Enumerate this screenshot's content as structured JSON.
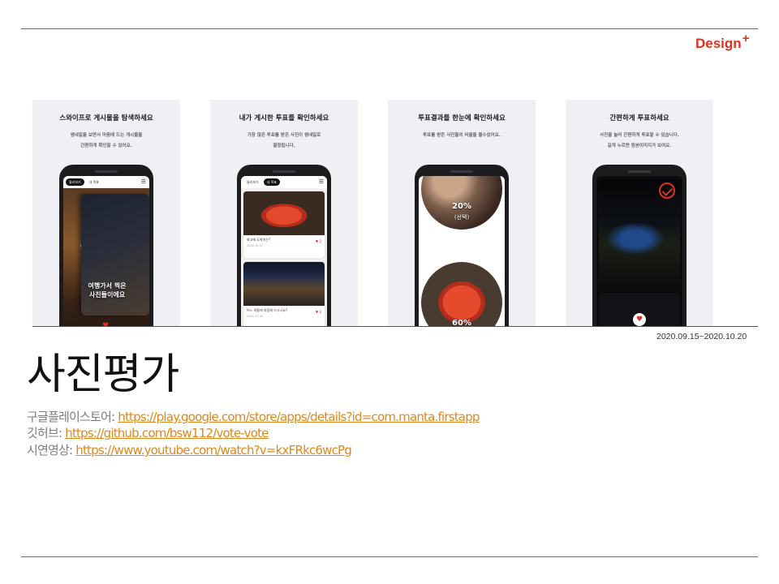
{
  "brand": {
    "text": "Design",
    "plus": "+"
  },
  "cards": [
    {
      "title": "스와이프로 게시물을 탐색하세요",
      "subtitle_line1": "썸네일을 보면서 마음에 드는 게시물을",
      "subtitle_line2": "간편하게 확인할 수 있어요.",
      "tabs": [
        "둘러보기",
        "내 목표"
      ],
      "caption_line1": "여행가서 찍은",
      "caption_line2": "사진들이에요"
    },
    {
      "title": "내가 게시한 투표를 확인하세요",
      "subtitle_line1": "가장 많은 투표를 받은 사진이 썸네일로",
      "subtitle_line2": "결정됩니다.",
      "tabs": [
        "둘러보기",
        "내 목표"
      ],
      "posts": [
        {
          "title": "최고에 도착하는?",
          "date": "2020.10.22",
          "likes": "5"
        },
        {
          "title": "어느 여름에 마음에 드시나요?",
          "date": "2020.10.22",
          "likes": "3"
        }
      ]
    },
    {
      "title": "투표결과를 한눈에 확인하세요",
      "subtitle_line1": "투표를 받은 사진들의 비율을 볼수있어요.",
      "subtitle_line2": "",
      "results": [
        {
          "percent": "20%",
          "note": "(선택)"
        },
        {
          "percent": "60%"
        }
      ]
    },
    {
      "title": "간편하게 투표하세요",
      "subtitle_line1": "사진을 눌러 간편하게 투표할 수 있습니다.",
      "subtitle_line2": "길게 누르면 원본이미지가 보여요."
    }
  ],
  "date_range": "2020.09.15~2020.10.20",
  "title": "사진평가",
  "links": [
    {
      "label": "구글플레이스토어: ",
      "url": "https://play.google.com/store/apps/details?id=com.manta.firstapp"
    },
    {
      "label": "깃허브: ",
      "url": "https://github.com/bsw112/vote-vote"
    },
    {
      "label": "시연영상: ",
      "url": "https://www.youtube.com/watch?v=kxFRkc6wcPg"
    }
  ],
  "colors": {
    "accent": "#e0301e",
    "link": "#e0871b"
  }
}
